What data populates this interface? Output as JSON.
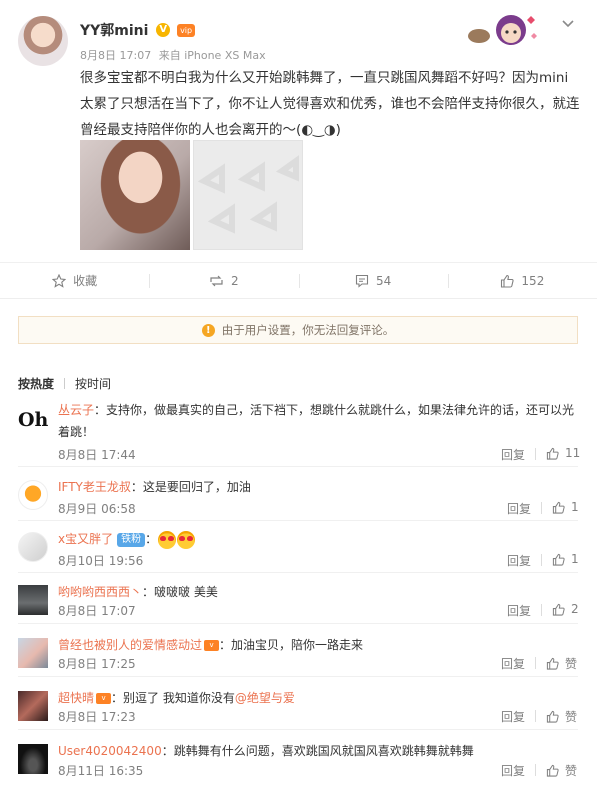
{
  "post": {
    "username": "YY郭mini",
    "verified_icon": "V",
    "vip_icon": "vip",
    "date": "8月8日 17:07",
    "source": "来自 iPhone XS Max",
    "text": "很多宝宝都不明白我为什么又开始跳韩舞了，一直只跳国风舞蹈不好吗？因为mini太累了只想活在当下了，你不让人觉得喜欢和优秀，谁也不会陪伴支持你很久，就连曾经最支持陪伴你的人也会离开的～(◐‿◑)",
    "images": [
      "photo-1",
      "photo-2-placeholder"
    ]
  },
  "actions": {
    "favorite_label": "收藏",
    "repost_count": "2",
    "comment_count": "54",
    "like_count": "152"
  },
  "notice": {
    "text": "由于用户设置，你无法回复评论。"
  },
  "sort": {
    "hot": "按热度",
    "time": "按时间"
  },
  "comments": [
    {
      "user": "丛云子",
      "text": "：支持你，做最真实的自己，活下裆下，想跳什么就跳什么，如果法律允许的话，还可以光着跳！",
      "time": "8月8日 17:44",
      "reply": "回复",
      "likes": "11",
      "avatar_text": "Oh"
    },
    {
      "user": "IFTY老王龙叔",
      "text": "：这是要回归了，加油",
      "time": "8月9日 06:58",
      "reply": "回复",
      "likes": "1"
    },
    {
      "user": "x宝又胖了",
      "badge": "铁粉",
      "text": "：",
      "time": "8月10日 19:56",
      "reply": "回复",
      "likes": "1"
    },
    {
      "user": "哟哟哟西西西丶",
      "text": "：啵啵啵 美美",
      "time": "8月8日 17:07",
      "reply": "回复",
      "likes": "2"
    },
    {
      "user": "曾经也被别人的爱情感动过",
      "text": "：加油宝贝，陪你一路走来",
      "time": "8月8日 17:25",
      "reply": "回复",
      "likes": "赞"
    },
    {
      "user": "超快晴",
      "text": "：别逗了 我知道你没有",
      "mention": "@绝望与爱",
      "time": "8月8日 17:23",
      "reply": "回复",
      "likes": "赞"
    },
    {
      "user": "User4020042400",
      "text": "：跳韩舞有什么问题，喜欢跳国风就国风喜欢跳韩舞就韩舞",
      "time": "8月11日 16:35",
      "reply": "回复",
      "likes": "赞"
    }
  ],
  "colors": {
    "accent": "#eb7350",
    "notice_bg": "#fdfaf3",
    "muted": "#808080"
  }
}
